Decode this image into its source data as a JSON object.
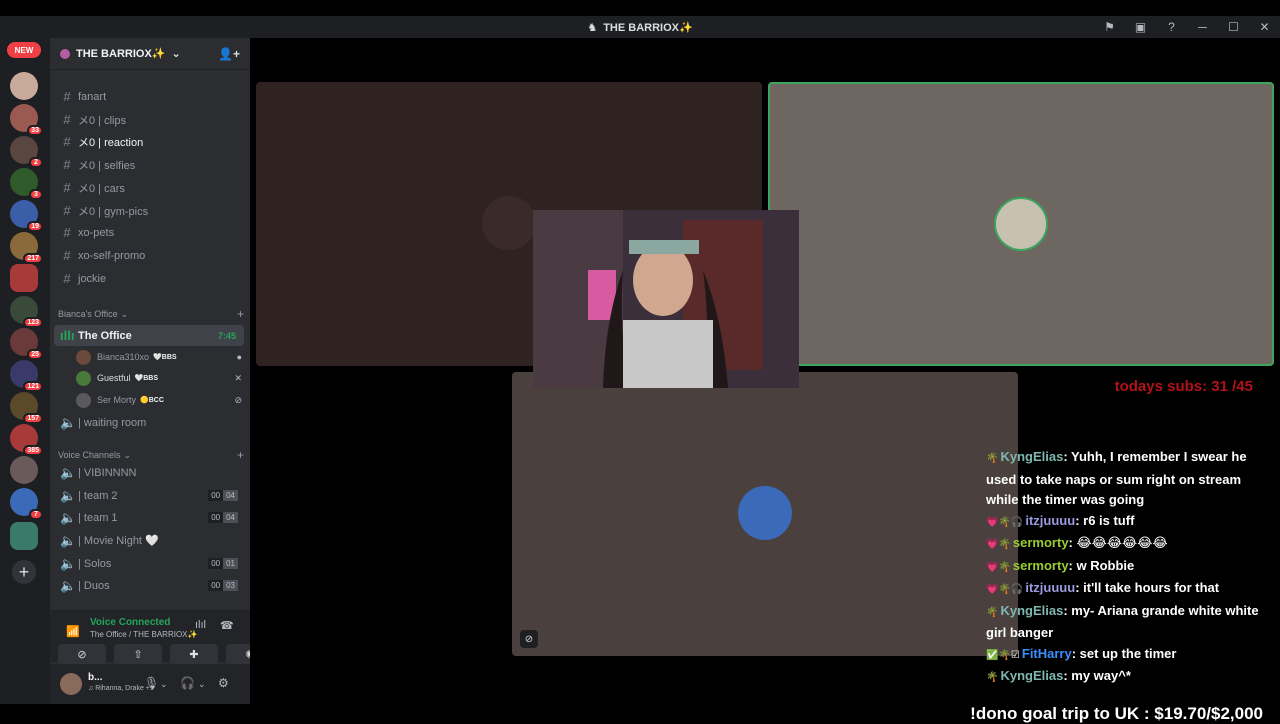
{
  "window": {
    "title": "THE BARRIOX✨",
    "controls": {
      "minimize": "─",
      "maximize": "☐",
      "close": "✕"
    }
  },
  "guild_rail": {
    "new_label": "NEW",
    "badges": [
      "33",
      "2",
      "3",
      "19",
      "217",
      "123",
      "25",
      "121",
      "157",
      "385",
      "7"
    ],
    "add_label": "+"
  },
  "server": {
    "name": "THE BARRIOX✨",
    "chevron": "⌄"
  },
  "channels": [
    {
      "label": "fanart",
      "kind": "text",
      "state": "normal"
    },
    {
      "label": "メ0 | clips",
      "kind": "text",
      "state": "normal"
    },
    {
      "label": "メ0 | reaction",
      "kind": "text",
      "state": "unread"
    },
    {
      "label": "メ0 | selfies",
      "kind": "text",
      "state": "normal"
    },
    {
      "label": "メ0 | cars",
      "kind": "text",
      "state": "normal"
    },
    {
      "label": "メ0 | gym-pics",
      "kind": "text",
      "state": "normal"
    },
    {
      "label": "xo-pets",
      "kind": "text",
      "state": "normal"
    },
    {
      "label": "xo-self-promo",
      "kind": "text",
      "state": "normal"
    },
    {
      "label": "jockie",
      "kind": "text",
      "state": "normal"
    }
  ],
  "category_office": {
    "label": "Bianca's Office"
  },
  "active_voice": {
    "label": "The Office",
    "time": "7:45"
  },
  "voice_users": [
    {
      "name": "Bianca310xo",
      "tag": "🤍BBS",
      "status": "●"
    },
    {
      "name": "Guestful",
      "tag": "🤍BBS",
      "status": "✕"
    },
    {
      "name": "Ser Morty",
      "tag": "🟡BCC",
      "status": "⊘"
    }
  ],
  "waiting_room": {
    "label": "| waiting room"
  },
  "category_voice": {
    "label": "Voice Channels"
  },
  "voice_channels": [
    {
      "label": "| VIBINNNN",
      "a": "",
      "b": ""
    },
    {
      "label": "| team 2",
      "a": "00",
      "b": "04"
    },
    {
      "label": "| team 1",
      "a": "00",
      "b": "04"
    },
    {
      "label": "| Movie Night 🤍",
      "a": "",
      "b": ""
    },
    {
      "label": "| Solos",
      "a": "00",
      "b": "01"
    },
    {
      "label": "| Duos",
      "a": "00",
      "b": "03"
    }
  ],
  "voice_panel": {
    "status": "Voice Connected",
    "location": "The Office / THE BARRIOX✨"
  },
  "user": {
    "name": "b...",
    "activity": "♫ Rihanna, Drake +1"
  },
  "overlay": {
    "subs": "todays subs: 31 /45",
    "dono": "!dono goal trip to UK : $19.70/$2,000"
  },
  "chat": [
    {
      "badges": "🌴",
      "user": "KyngElias",
      "color": "#7fb8b0",
      "text": ": Yuhh, I remember I swear he used to take naps or sum right on stream while the timer was going"
    },
    {
      "badges": "💗🌴🎧",
      "user": "itzjuuuu",
      "color": "#9a9adf",
      "text": ": r6 is tuff"
    },
    {
      "badges": "💗🌴",
      "user": "sermorty",
      "color": "#9acd32",
      "text": ": 😂😂😂😂😂😂"
    },
    {
      "badges": "💗🌴",
      "user": "sermorty",
      "color": "#9acd32",
      "text": ": w Robbie"
    },
    {
      "badges": "💗🌴🎧",
      "user": "itzjuuuu",
      "color": "#9a9adf",
      "text": ": it'll take hours for that"
    },
    {
      "badges": "🌴",
      "user": "KyngElias",
      "color": "#7fb8b0",
      "text": ": my- Ariana grande white white girl banger"
    },
    {
      "badges": "✅🌴☑",
      "user": "FitHarry",
      "color": "#3a8fff",
      "text": ": set up the timer"
    },
    {
      "badges": "🌴",
      "user": "KyngElias",
      "color": "#7fb8b0",
      "text": ": my way^*"
    }
  ],
  "colors": {
    "accent_green": "#23a55a",
    "speaking_border": "#3ba55c",
    "subs_red": "#b1121a"
  }
}
